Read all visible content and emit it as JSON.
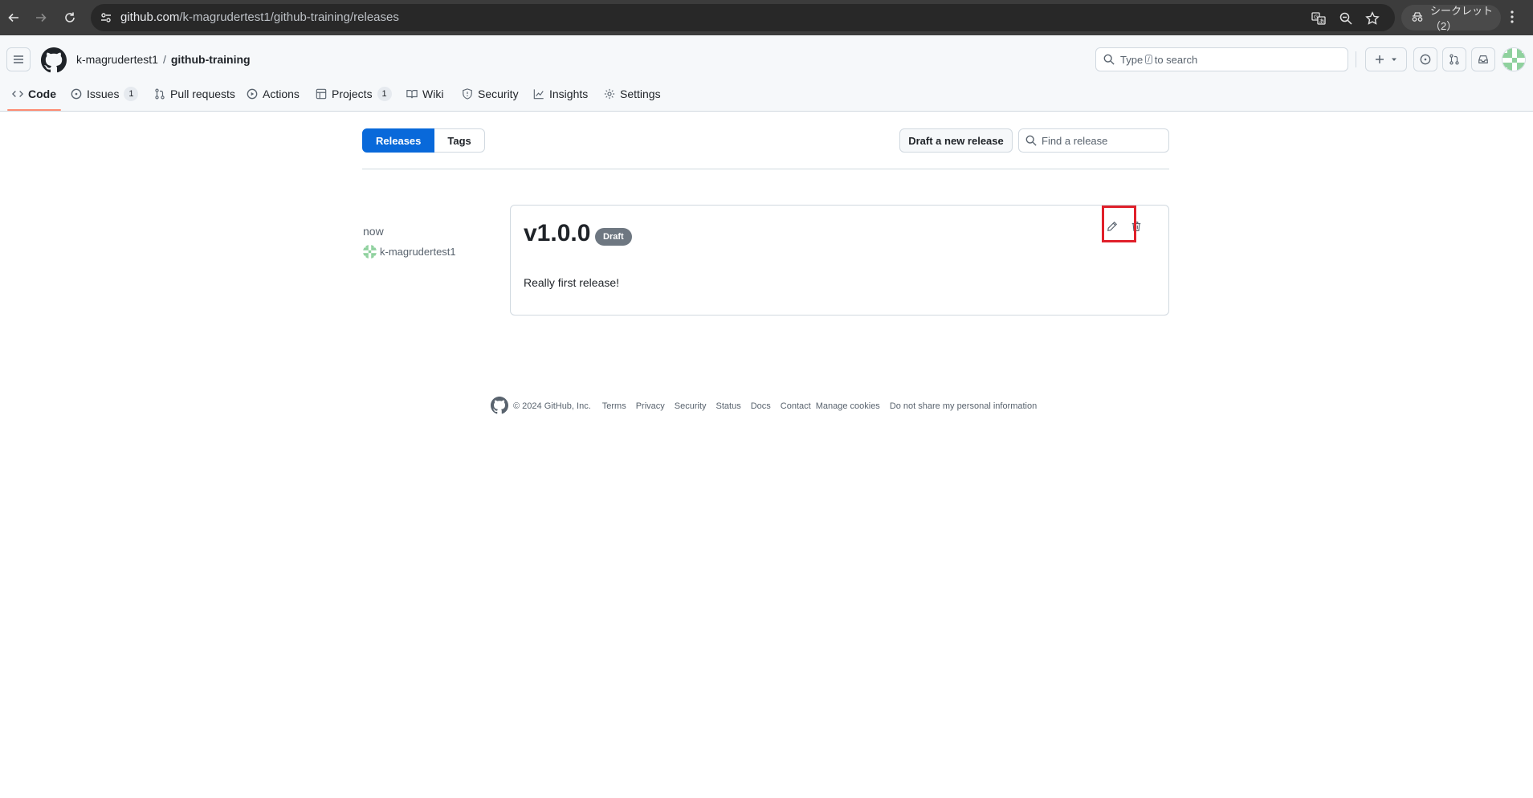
{
  "browser": {
    "url_domain": "github.com",
    "url_path": "/k-magrudertest1/github-training/releases",
    "incognito_label": "シークレット（2）"
  },
  "header": {
    "owner": "k-magrudertest1",
    "separator": "/",
    "repo": "github-training",
    "search_prefix": "Type",
    "search_key": "/",
    "search_suffix": "to search"
  },
  "tabs": [
    {
      "label": "Code",
      "count": null,
      "icon": "code-icon",
      "active": true
    },
    {
      "label": "Issues",
      "count": "1",
      "icon": "issue-icon"
    },
    {
      "label": "Pull requests",
      "count": null,
      "icon": "pull-request-icon"
    },
    {
      "label": "Actions",
      "count": null,
      "icon": "play-icon"
    },
    {
      "label": "Projects",
      "count": "1",
      "icon": "table-icon"
    },
    {
      "label": "Wiki",
      "count": null,
      "icon": "book-icon"
    },
    {
      "label": "Security",
      "count": null,
      "icon": "shield-icon"
    },
    {
      "label": "Insights",
      "count": null,
      "icon": "graph-icon"
    },
    {
      "label": "Settings",
      "count": null,
      "icon": "gear-icon"
    }
  ],
  "releases_nav": {
    "releases_label": "Releases",
    "tags_label": "Tags",
    "draft_button": "Draft a new release",
    "find_placeholder": "Find a release"
  },
  "release": {
    "time": "now",
    "author": "k-magrudertest1",
    "title": "v1.0.0",
    "badge": "Draft",
    "body": "Really first release!"
  },
  "footer": {
    "copyright": "© 2024 GitHub, Inc.",
    "links": [
      "Terms",
      "Privacy",
      "Security",
      "Status",
      "Docs",
      "Contact",
      "Manage cookies",
      "Do not share my personal information"
    ]
  },
  "colors": {
    "accent": "#0969da",
    "active_tab_underline": "#fd8c73",
    "highlight_box": "#e0202a",
    "draft_badge": "#6e7781"
  }
}
